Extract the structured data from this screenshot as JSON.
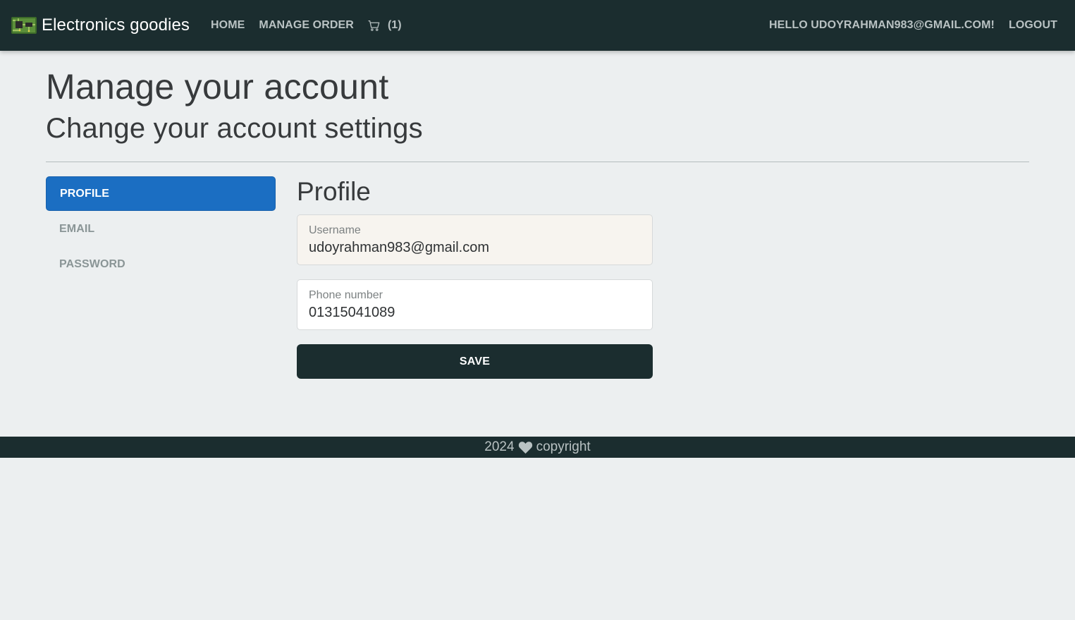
{
  "navbar": {
    "brand": "Electronics goodies",
    "brand_icon": "circuit-board-icon",
    "links": [
      {
        "label": "Home"
      },
      {
        "label": "Manage Order"
      }
    ],
    "cart_icon": "cart-icon",
    "cart_count": "(1)",
    "greeting": "Hello udoyrahman983@gmail.com!",
    "logout": "Logout"
  },
  "page": {
    "title": "Manage your account",
    "subtitle": "Change your account settings"
  },
  "side_nav": {
    "items": [
      {
        "label": "Profile",
        "active": true
      },
      {
        "label": "Email",
        "active": false
      },
      {
        "label": "Password",
        "active": false
      }
    ]
  },
  "profile": {
    "title": "Profile",
    "username": {
      "label": "Username",
      "value": "udoyrahman983@gmail.com"
    },
    "phone": {
      "label": "Phone number",
      "value": "01315041089"
    },
    "save_label": "Save"
  },
  "footer": {
    "year": "2024",
    "heart_icon": "heart-icon",
    "text": "copyright"
  },
  "colors": {
    "navbar_bg": "#1b2d2f",
    "accent": "#1b6ec2",
    "page_bg": "#eceff0"
  }
}
